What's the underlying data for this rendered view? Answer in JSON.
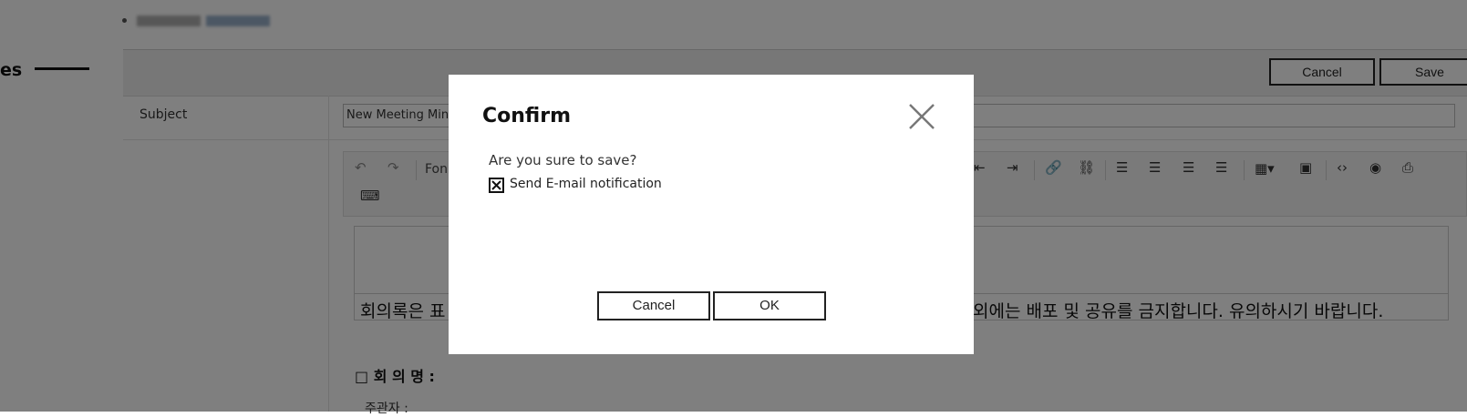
{
  "page": {
    "heading": "es",
    "topbar": {
      "cancel_label": "Cancel",
      "save_label": "Save"
    },
    "subject": {
      "label": "Subject",
      "value": "New Meeting Minu"
    },
    "editor": {
      "font_label": "Fon",
      "notice_left": "회의록은 표",
      "notice_right": "외에는 배포 및 공유를 금지합니다. 유의하시기 바랍니다.",
      "meeting_heading": "□ 회 의 명 :",
      "organizer_label": "주관자 :"
    }
  },
  "dialog": {
    "title": "Confirm",
    "message": "Are you sure to save?",
    "checkbox_label": "Send E-mail notification",
    "checkbox_checked": true,
    "cancel_label": "Cancel",
    "ok_label": "OK"
  }
}
